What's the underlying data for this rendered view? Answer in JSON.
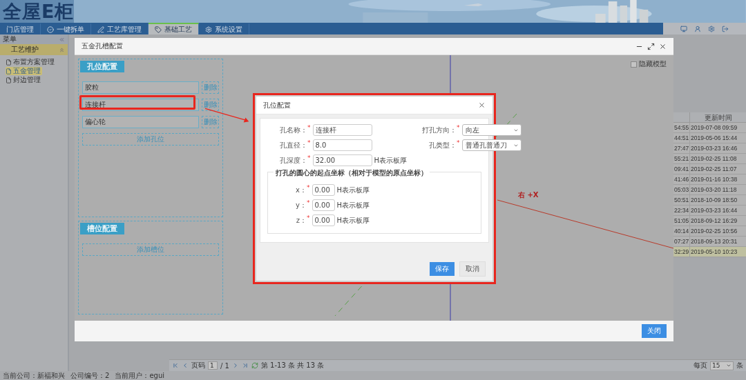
{
  "header": {
    "logo": "全屋E柜",
    "nav": [
      {
        "label": "门店管理",
        "kind": "plain",
        "selected": false
      },
      {
        "label": "一键拆单",
        "kind": "check",
        "selected": false
      },
      {
        "label": "工艺库管理",
        "kind": "pen",
        "selected": false
      },
      {
        "label": "基础工艺",
        "kind": "tag",
        "selected": true
      },
      {
        "label": "系统设置",
        "kind": "gear",
        "selected": false
      }
    ]
  },
  "sidebar": {
    "title": "菜单",
    "section": "工艺维护",
    "items": [
      {
        "label": "布置方案管理",
        "selected": false
      },
      {
        "label": "五金管理",
        "selected": true
      },
      {
        "label": "封边管理",
        "selected": false
      }
    ]
  },
  "table": {
    "columns": [
      "更新时间"
    ],
    "rows": [
      {
        "column_1": "54:55",
        "updated": "2019-07-08 09:59",
        "selected": false
      },
      {
        "column_1": "44:51",
        "updated": "2019-05-06 15:44",
        "selected": false
      },
      {
        "column_1": "27:47",
        "updated": "2019-03-23 16:46",
        "selected": false
      },
      {
        "column_1": "55:21",
        "updated": "2019-02-25 11:08",
        "selected": false
      },
      {
        "column_1": "09:41",
        "updated": "2019-02-25 11:07",
        "selected": false
      },
      {
        "column_1": "41:46",
        "updated": "2019-01-16 10:38",
        "selected": false
      },
      {
        "column_1": "05:03",
        "updated": "2019-03-20 11:18",
        "selected": false
      },
      {
        "column_1": "50:51",
        "updated": "2018-10-09 18:50",
        "selected": false
      },
      {
        "column_1": "22:34",
        "updated": "2019-03-23 16:44",
        "selected": false
      },
      {
        "column_1": "51:05",
        "updated": "2018-09-12 16:29",
        "selected": false
      },
      {
        "column_1": "40:14",
        "updated": "2019-02-25 10:56",
        "selected": false
      },
      {
        "column_1": "07:27",
        "updated": "2018-09-13 20:31",
        "selected": false
      },
      {
        "column_1": "32:29",
        "updated": "2019-05-10 10:23",
        "selected": true
      }
    ]
  },
  "pager": {
    "page_label": "页码",
    "page": "1",
    "total_pages": "/ 1",
    "summary": "第 1-13 条 共 13 条",
    "per_page_label": "每页",
    "per_page": "15",
    "per_page_unit": "条"
  },
  "status_bar": [
    "当前公司：新福和兴",
    "公司编号：2",
    "当前用户：egui"
  ],
  "hardware_dialog": {
    "title": "五金孔槽配置",
    "hide_model": {
      "label": "隐藏模型",
      "checked": false
    },
    "axis_label": "右 +X",
    "hole_section": {
      "title": "孔位配置",
      "add": "添加孔位",
      "holes": [
        {
          "name": "胶粒",
          "delete": "删除",
          "highlighted": false
        },
        {
          "name": "连接杆",
          "delete": "删除",
          "highlighted": true
        },
        {
          "name": "偏心轮",
          "delete": "删除",
          "highlighted": false
        }
      ]
    },
    "slot_section": {
      "title": "槽位配置",
      "add": "添加槽位"
    },
    "close": "关闭"
  },
  "hole_dialog": {
    "title": "孔位配置",
    "fields": [
      {
        "label": "孔名称：",
        "mark": "*",
        "value": "连接杆",
        "kind": "input"
      },
      {
        "label": "打孔方向：",
        "mark": "*",
        "value": "向左",
        "kind": "select"
      },
      {
        "label": "孔直径：",
        "mark": "*",
        "value": "8.0",
        "kind": "input"
      },
      {
        "label": "孔类型：",
        "mark": "*",
        "value": "普通孔普通刀",
        "kind": "select"
      },
      {
        "label": "孔深度：",
        "mark": "*",
        "value": "32.00",
        "kind": "input",
        "hint": "H表示板厚"
      }
    ],
    "origin": {
      "legend": "打孔的圆心的起点坐标（相对于模型的原点坐标）",
      "fields": [
        {
          "label": "x：",
          "mark": "*",
          "value": "0.00",
          "hint": "H表示板厚"
        },
        {
          "label": "y：",
          "mark": "*",
          "value": "0.00",
          "hint": "H表示板厚"
        },
        {
          "label": "z：",
          "mark": "*",
          "value": "0.00",
          "hint": "H表示板厚"
        }
      ]
    },
    "save": "保存",
    "cancel": "取消"
  }
}
